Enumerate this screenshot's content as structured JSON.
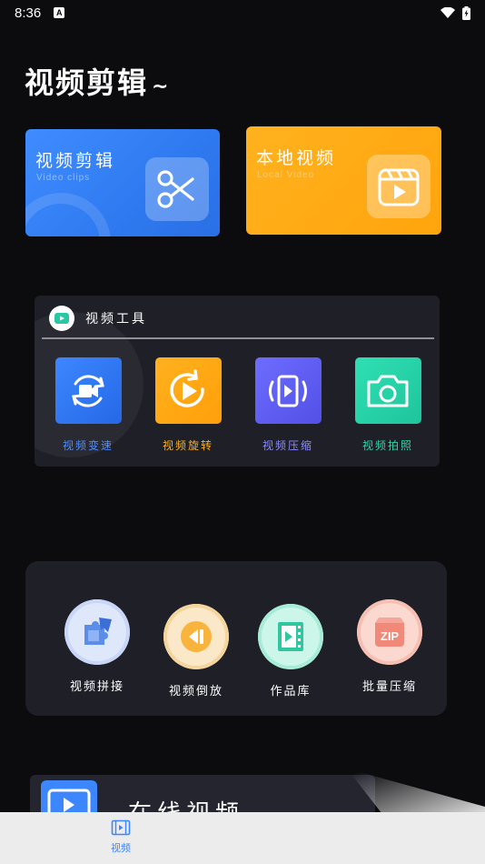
{
  "status_bar": {
    "time": "8:36",
    "notification_badge": "A",
    "icons": [
      "wifi-icon",
      "battery-icon"
    ]
  },
  "page": {
    "title": "视频剪辑",
    "title_suffix": "~"
  },
  "cards": {
    "clip": {
      "title": "视频剪辑",
      "subtitle": "Video clips",
      "icon": "scissors-icon",
      "color": "#3f8cff"
    },
    "local": {
      "title": "本地视频",
      "subtitle": "Local Video",
      "icon": "film-play-icon",
      "color": "#ffa40d"
    }
  },
  "tools": {
    "header": "视频工具",
    "items": [
      {
        "label": "视频变速",
        "icon": "camera-rotate-icon",
        "color": "#2f7af0",
        "label_color": "#4f8dff"
      },
      {
        "label": "视频旋转",
        "icon": "play-rotate-icon",
        "color": "#ffa40d",
        "label_color": "#ffb21e"
      },
      {
        "label": "视频压缩",
        "icon": "video-compress-icon",
        "color": "#6d6cff",
        "label_color": "#8c8bff"
      },
      {
        "label": "视频拍照",
        "icon": "camera-icon",
        "color": "#25d3a8",
        "label_color": "#2fd6ab"
      }
    ]
  },
  "more": {
    "items": [
      {
        "label": "视频拼接",
        "icon": "puzzle-icon"
      },
      {
        "label": "视频倒放",
        "icon": "rewind-icon"
      },
      {
        "label": "作品库",
        "icon": "film-library-icon"
      },
      {
        "label": "批量压缩",
        "icon": "zip-icon"
      }
    ]
  },
  "online": {
    "title": "在线视频"
  },
  "bottom_nav": {
    "items": [
      {
        "label": "视频",
        "icon": "video-tab-icon",
        "active": true
      }
    ],
    "active_color": "#3c86ff"
  }
}
